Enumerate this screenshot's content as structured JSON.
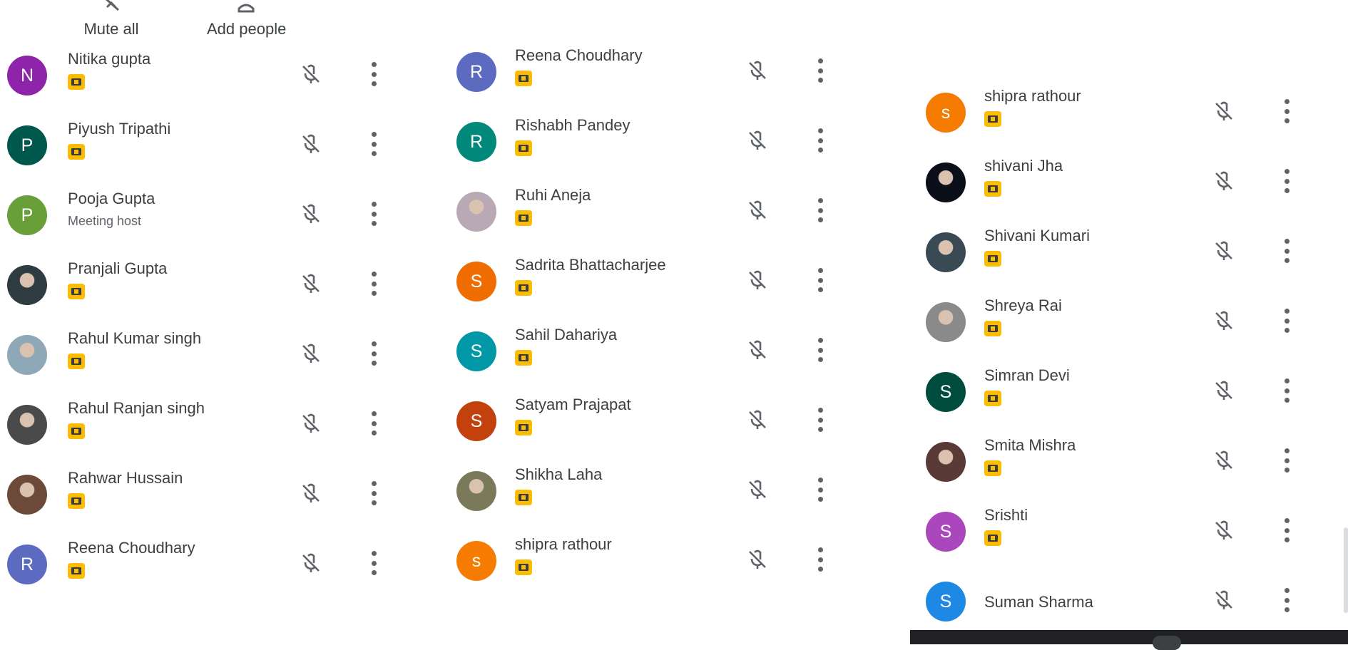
{
  "toolbar": {
    "mute_all_label": "Mute all",
    "add_people_label": "Add people",
    "mute_icon": "mic-off-icon",
    "add_icon": "add-person-icon"
  },
  "columns": [
    {
      "participants": [
        {
          "name": "Nitika gupta",
          "initial": "N",
          "color": "#8e24aa",
          "avatar_type": "letter",
          "badge": "meeting-present-icon"
        },
        {
          "name": "Piyush Tripathi",
          "initial": "P",
          "color": "#00574b",
          "avatar_type": "letter",
          "badge": "meeting-present-icon"
        },
        {
          "name": "Pooja Gupta",
          "initial": "P",
          "color": "#689f38",
          "avatar_type": "letter",
          "subtitle": "Meeting host"
        },
        {
          "name": "Pranjali Gupta",
          "initial": "",
          "color": "#2e3b40",
          "avatar_type": "photo",
          "badge": "meeting-present-icon"
        },
        {
          "name": "Rahul Kumar singh",
          "initial": "",
          "color": "#8fa8b8",
          "avatar_type": "photo",
          "badge": "meeting-present-icon"
        },
        {
          "name": "Rahul Ranjan singh",
          "initial": "",
          "color": "#4a4a4a",
          "avatar_type": "photo",
          "badge": "meeting-present-icon"
        },
        {
          "name": "Rahwar Hussain",
          "initial": "",
          "color": "#6b4a3a",
          "avatar_type": "photo",
          "badge": "meeting-present-icon"
        },
        {
          "name": "Reena Choudhary",
          "initial": "R",
          "color": "#5c6bc0",
          "avatar_type": "letter",
          "badge": "meeting-present-icon"
        }
      ]
    },
    {
      "participants": [
        {
          "name": "Reena Choudhary",
          "initial": "R",
          "color": "#5c6bc0",
          "avatar_type": "letter",
          "badge": "meeting-present-icon"
        },
        {
          "name": "Rishabh Pandey",
          "initial": "R",
          "color": "#00897b",
          "avatar_type": "letter",
          "badge": "meeting-present-icon"
        },
        {
          "name": "Ruhi Aneja",
          "initial": "",
          "color": "#b9a9b4",
          "avatar_type": "photo",
          "badge": "meeting-present-icon"
        },
        {
          "name": "Sadrita Bhattacharjee",
          "initial": "S",
          "color": "#ef6c00",
          "avatar_type": "letter",
          "badge": "meeting-present-icon"
        },
        {
          "name": "Sahil Dahariya",
          "initial": "S",
          "color": "#0097a7",
          "avatar_type": "letter",
          "badge": "meeting-present-icon"
        },
        {
          "name": "Satyam Prajapat",
          "initial": "S",
          "color": "#c2410c",
          "avatar_type": "letter",
          "badge": "meeting-present-icon"
        },
        {
          "name": "Shikha Laha",
          "initial": "",
          "color": "#7a7a5a",
          "avatar_type": "photo",
          "badge": "meeting-present-icon"
        },
        {
          "name": "shipra rathour",
          "initial": "s",
          "color": "#f57c00",
          "avatar_type": "letter",
          "badge": "meeting-present-icon"
        }
      ]
    },
    {
      "participants": [
        {
          "name": "shipra rathour",
          "initial": "s",
          "color": "#f57c00",
          "avatar_type": "letter",
          "badge": "meeting-present-icon"
        },
        {
          "name": "shivani Jha",
          "initial": "",
          "color": "#0a0f1a",
          "avatar_type": "photo",
          "badge": "meeting-present-icon"
        },
        {
          "name": "Shivani Kumari",
          "initial": "",
          "color": "#3a4a55",
          "avatar_type": "photo",
          "badge": "meeting-present-icon"
        },
        {
          "name": "Shreya Rai",
          "initial": "",
          "color": "#8a8a8a",
          "avatar_type": "photo",
          "badge": "meeting-present-icon"
        },
        {
          "name": "Simran Devi",
          "initial": "S",
          "color": "#004d40",
          "avatar_type": "letter",
          "badge": "meeting-present-icon"
        },
        {
          "name": "Smita Mishra",
          "initial": "",
          "color": "#5a3a36",
          "avatar_type": "photo",
          "badge": "meeting-present-icon"
        },
        {
          "name": "Srishti",
          "initial": "S",
          "color": "#ab47bc",
          "avatar_type": "letter",
          "badge": "meeting-present-icon"
        },
        {
          "name": "Suman Sharma",
          "initial": "S",
          "color": "#1e88e5",
          "avatar_type": "letter"
        }
      ]
    }
  ],
  "row_icons": {
    "mic": "mic-off-icon",
    "more": "more-vert-icon"
  },
  "colors": {
    "badge": "#fbbc04",
    "icon_gray": "#5f6368",
    "text": "#3c4043"
  }
}
